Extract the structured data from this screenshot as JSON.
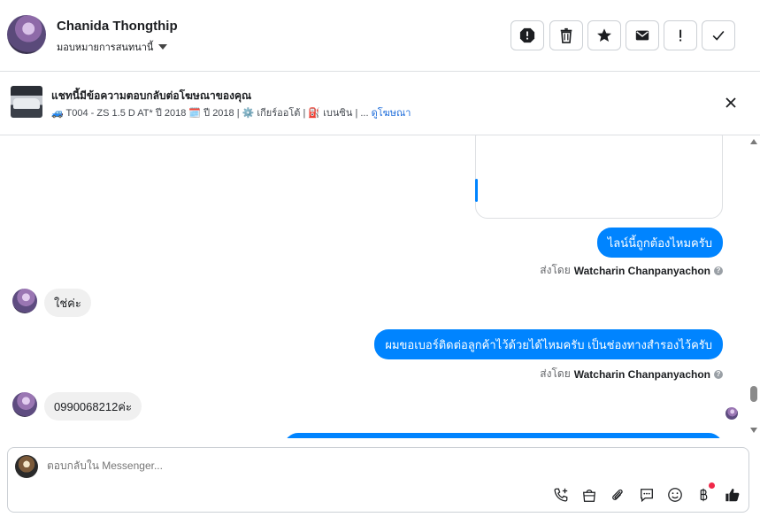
{
  "header": {
    "contact_name": "Chanida Thongthip",
    "assign_label": "มอบหมายการสนทนานี้",
    "actions": [
      {
        "icon": "alert-icon",
        "label": "spam"
      },
      {
        "icon": "trash-icon",
        "label": "delete"
      },
      {
        "icon": "star-icon",
        "label": "follow-up"
      },
      {
        "icon": "mail-icon",
        "label": "mark-unread"
      },
      {
        "icon": "exclamation-icon",
        "label": "important"
      },
      {
        "icon": "check-icon",
        "label": "done"
      }
    ]
  },
  "ad": {
    "title": "แชทนี้มีข้อความตอบกลับต่อโฆษณาของคุณ",
    "subtitle": "🚙 T004 - ZS 1.5 D AT* ปี 2018 🗓️ ปี 2018 | ⚙️ เกียร์ออโต้ | ⛽ เบนซิน | ...",
    "link": "ดูโฆษณา"
  },
  "messages": [
    {
      "dir": "out",
      "text": "ไลน์นี้ถูกต้องไหมครับ"
    },
    {
      "dir": "meta",
      "prefix": "ส่งโดย",
      "sender": "Watcharin Chanpanyachon"
    },
    {
      "dir": "in",
      "text": "ใช่ค่ะ"
    },
    {
      "dir": "out",
      "text": "ผมขอเบอร์ติดต่อลูกค้าไว้ด้วยได้ไหมครับ เป็นช่องทางสำรองไว้ครับ"
    },
    {
      "dir": "meta",
      "prefix": "ส่งโดย",
      "sender": "Watcharin Chanpanyachon"
    },
    {
      "dir": "in",
      "text": "0990068212ค่ะ"
    }
  ],
  "composer": {
    "placeholder": "ตอบกลับใน Messenger...",
    "tools": [
      "phone-icon",
      "shopping-bag-icon",
      "paperclip-icon",
      "chat-bubble-icon",
      "smiley-icon",
      "baht-icon",
      "thumbs-up-icon"
    ]
  },
  "colors": {
    "accent": "#0084ff",
    "incoming_bubble": "#f0f0f0",
    "link": "#216fdb",
    "notification": "#f02849"
  }
}
